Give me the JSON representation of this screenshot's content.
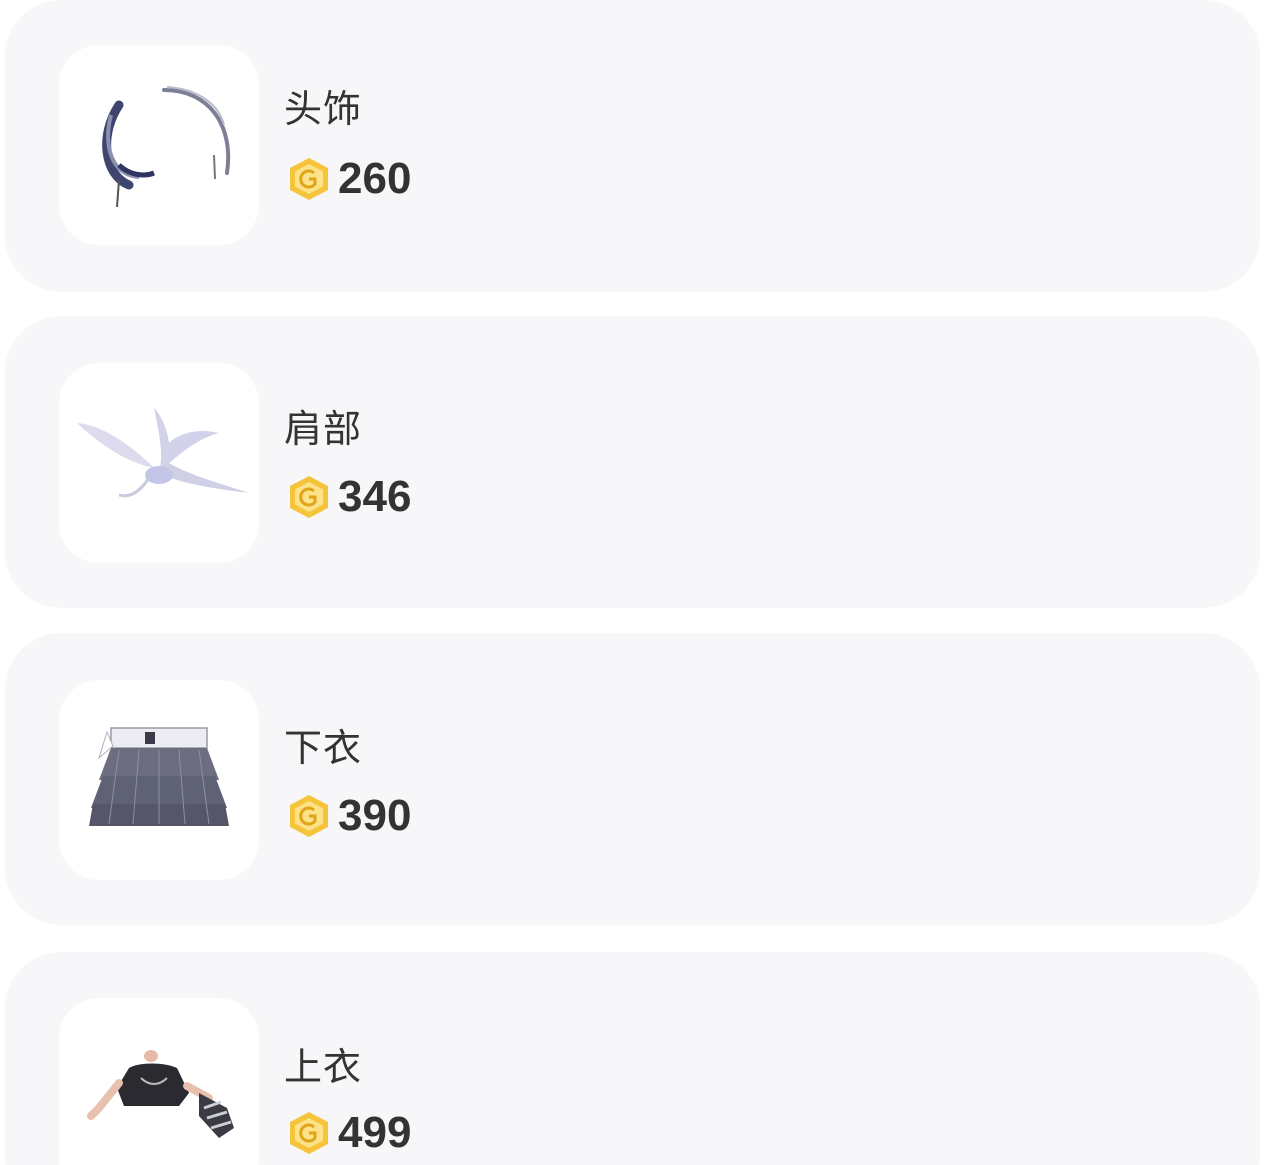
{
  "items": [
    {
      "name": "头饰",
      "price": "260",
      "icon": "headpiece-image"
    },
    {
      "name": "肩部",
      "price": "346",
      "icon": "shoulder-bird-image"
    },
    {
      "name": "下衣",
      "price": "390",
      "icon": "skirt-image"
    },
    {
      "name": "上衣",
      "price": "499",
      "icon": "top-image"
    }
  ],
  "colors": {
    "card_background": "#f7f7f9",
    "text": "#333333",
    "coin_outer": "#f5c43a",
    "coin_inner": "#fde28a"
  }
}
